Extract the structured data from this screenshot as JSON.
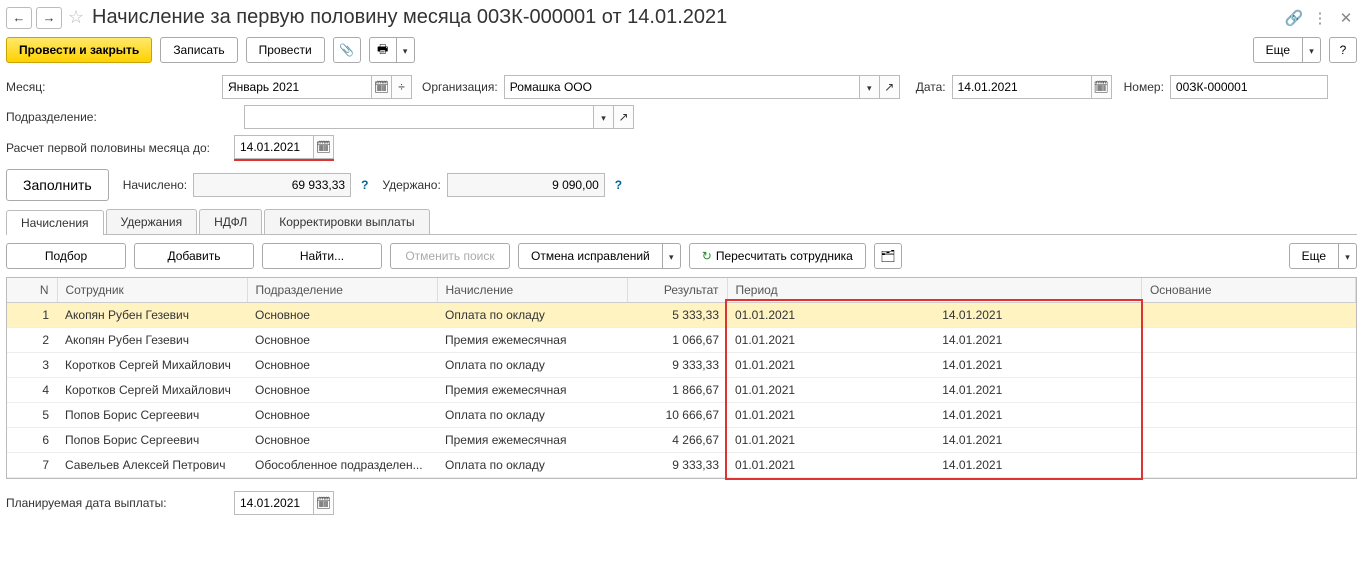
{
  "header": {
    "title": "Начисление за первую половину месяца 00ЗК-000001 от 14.01.2021"
  },
  "toolbar": {
    "post_and_close": "Провести и закрыть",
    "save": "Записать",
    "post": "Провести",
    "more": "Еще"
  },
  "form": {
    "month_label": "Месяц:",
    "month_value": "Январь 2021",
    "org_label": "Организация:",
    "org_value": "Ромашка ООО",
    "date_label": "Дата:",
    "date_value": "14.01.2021",
    "number_label": "Номер:",
    "number_value": "00ЗК-000001",
    "dept_label": "Подразделение:",
    "dept_value": "",
    "calc_until_label": "Расчет первой половины месяца до:",
    "calc_until_value": "14.01.2021",
    "fill": "Заполнить",
    "accrued_label": "Начислено:",
    "accrued_value": "69 933,33",
    "withheld_label": "Удержано:",
    "withheld_value": "9 090,00",
    "planned_date_label": "Планируемая дата выплаты:",
    "planned_date_value": "14.01.2021"
  },
  "tabs": [
    "Начисления",
    "Удержания",
    "НДФЛ",
    "Корректировки выплаты"
  ],
  "subtoolbar": {
    "pick": "Подбор",
    "add": "Добавить",
    "find": "Найти...",
    "cancel_search": "Отменить поиск",
    "cancel_corrections": "Отмена исправлений",
    "recalc_employee": "Пересчитать сотрудника",
    "more": "Еще"
  },
  "table": {
    "headers": {
      "n": "N",
      "employee": "Сотрудник",
      "department": "Подразделение",
      "calculation": "Начисление",
      "result": "Результат",
      "period": "Период",
      "basis": "Основание"
    },
    "rows": [
      {
        "n": 1,
        "employee": "Акопян Рубен Гезевич",
        "department": "Основное",
        "calculation": "Оплата по окладу",
        "result": "5 333,33",
        "period_from": "01.01.2021",
        "period_to": "14.01.2021",
        "basis": ""
      },
      {
        "n": 2,
        "employee": "Акопян Рубен Гезевич",
        "department": "Основное",
        "calculation": "Премия ежемесячная",
        "result": "1 066,67",
        "period_from": "01.01.2021",
        "period_to": "14.01.2021",
        "basis": ""
      },
      {
        "n": 3,
        "employee": "Коротков Сергей Михайлович",
        "department": "Основное",
        "calculation": "Оплата по окладу",
        "result": "9 333,33",
        "period_from": "01.01.2021",
        "period_to": "14.01.2021",
        "basis": ""
      },
      {
        "n": 4,
        "employee": "Коротков Сергей Михайлович",
        "department": "Основное",
        "calculation": "Премия ежемесячная",
        "result": "1 866,67",
        "period_from": "01.01.2021",
        "period_to": "14.01.2021",
        "basis": ""
      },
      {
        "n": 5,
        "employee": "Попов Борис Сергеевич",
        "department": "Основное",
        "calculation": "Оплата по окладу",
        "result": "10 666,67",
        "period_from": "01.01.2021",
        "period_to": "14.01.2021",
        "basis": ""
      },
      {
        "n": 6,
        "employee": "Попов Борис Сергеевич",
        "department": "Основное",
        "calculation": "Премия ежемесячная",
        "result": "4 266,67",
        "period_from": "01.01.2021",
        "period_to": "14.01.2021",
        "basis": ""
      },
      {
        "n": 7,
        "employee": "Савельев Алексей Петрович",
        "department": "Обособленное подразделен...",
        "calculation": "Оплата по окладу",
        "result": "9 333,33",
        "period_from": "01.01.2021",
        "period_to": "14.01.2021",
        "basis": ""
      }
    ]
  }
}
